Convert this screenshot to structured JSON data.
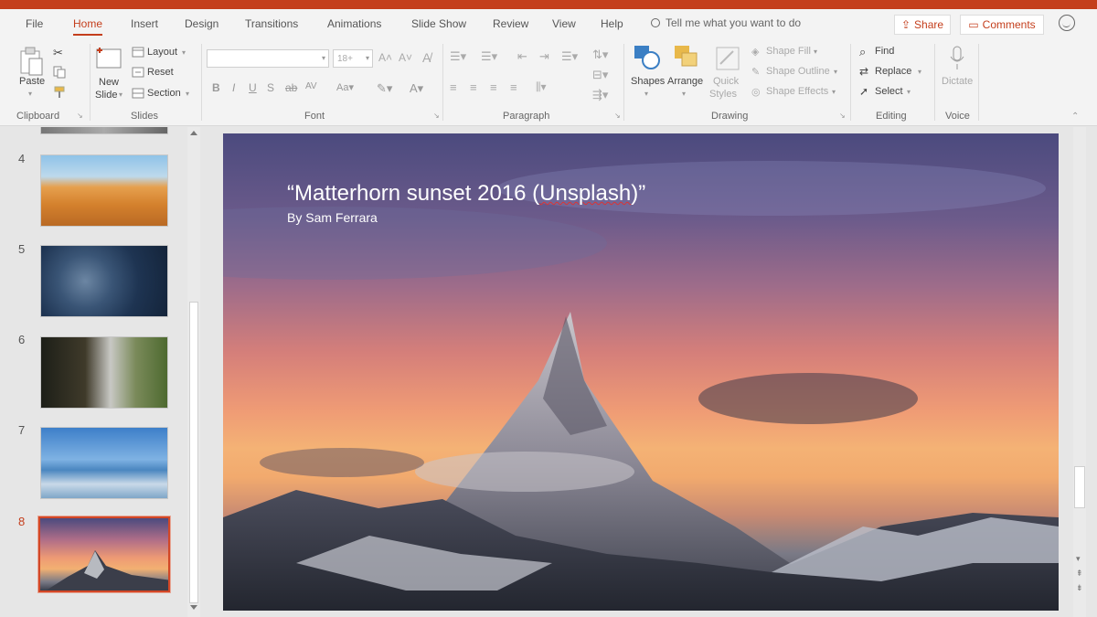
{
  "tabs": [
    "File",
    "Home",
    "Insert",
    "Design",
    "Transitions",
    "Animations",
    "Slide Show",
    "Review",
    "View",
    "Help"
  ],
  "active_tab": "Home",
  "tell_me": "Tell me what you want to do",
  "share_label": "Share",
  "comments_label": "Comments",
  "ribbon": {
    "clipboard": {
      "label": "Clipboard",
      "paste": "Paste"
    },
    "slides": {
      "label": "Slides",
      "new_slide_1": "New",
      "new_slide_2": "Slide",
      "layout": "Layout",
      "reset": "Reset",
      "section": "Section"
    },
    "font": {
      "label": "Font",
      "size": "18+"
    },
    "paragraph": {
      "label": "Paragraph"
    },
    "drawing": {
      "label": "Drawing",
      "shapes": "Shapes",
      "arrange": "Arrange",
      "quick_styles_1": "Quick",
      "quick_styles_2": "Styles",
      "shape_fill": "Shape Fill",
      "shape_outline": "Shape Outline",
      "shape_effects": "Shape Effects"
    },
    "editing": {
      "label": "Editing",
      "find": "Find",
      "replace": "Replace",
      "select": "Select"
    },
    "voice": {
      "label": "Voice",
      "dictate": "Dictate"
    }
  },
  "slides": [
    {
      "number": "4"
    },
    {
      "number": "5"
    },
    {
      "number": "6"
    },
    {
      "number": "7"
    },
    {
      "number": "8"
    }
  ],
  "current_slide": {
    "title_prefix": "“Matterhorn sunset 2016 (",
    "title_misspelled": "Unsplash",
    "title_suffix": ")”",
    "subtitle": "By Sam Ferrara"
  },
  "colors": {
    "accent": "#c43e1c",
    "selection": "#d24726"
  }
}
